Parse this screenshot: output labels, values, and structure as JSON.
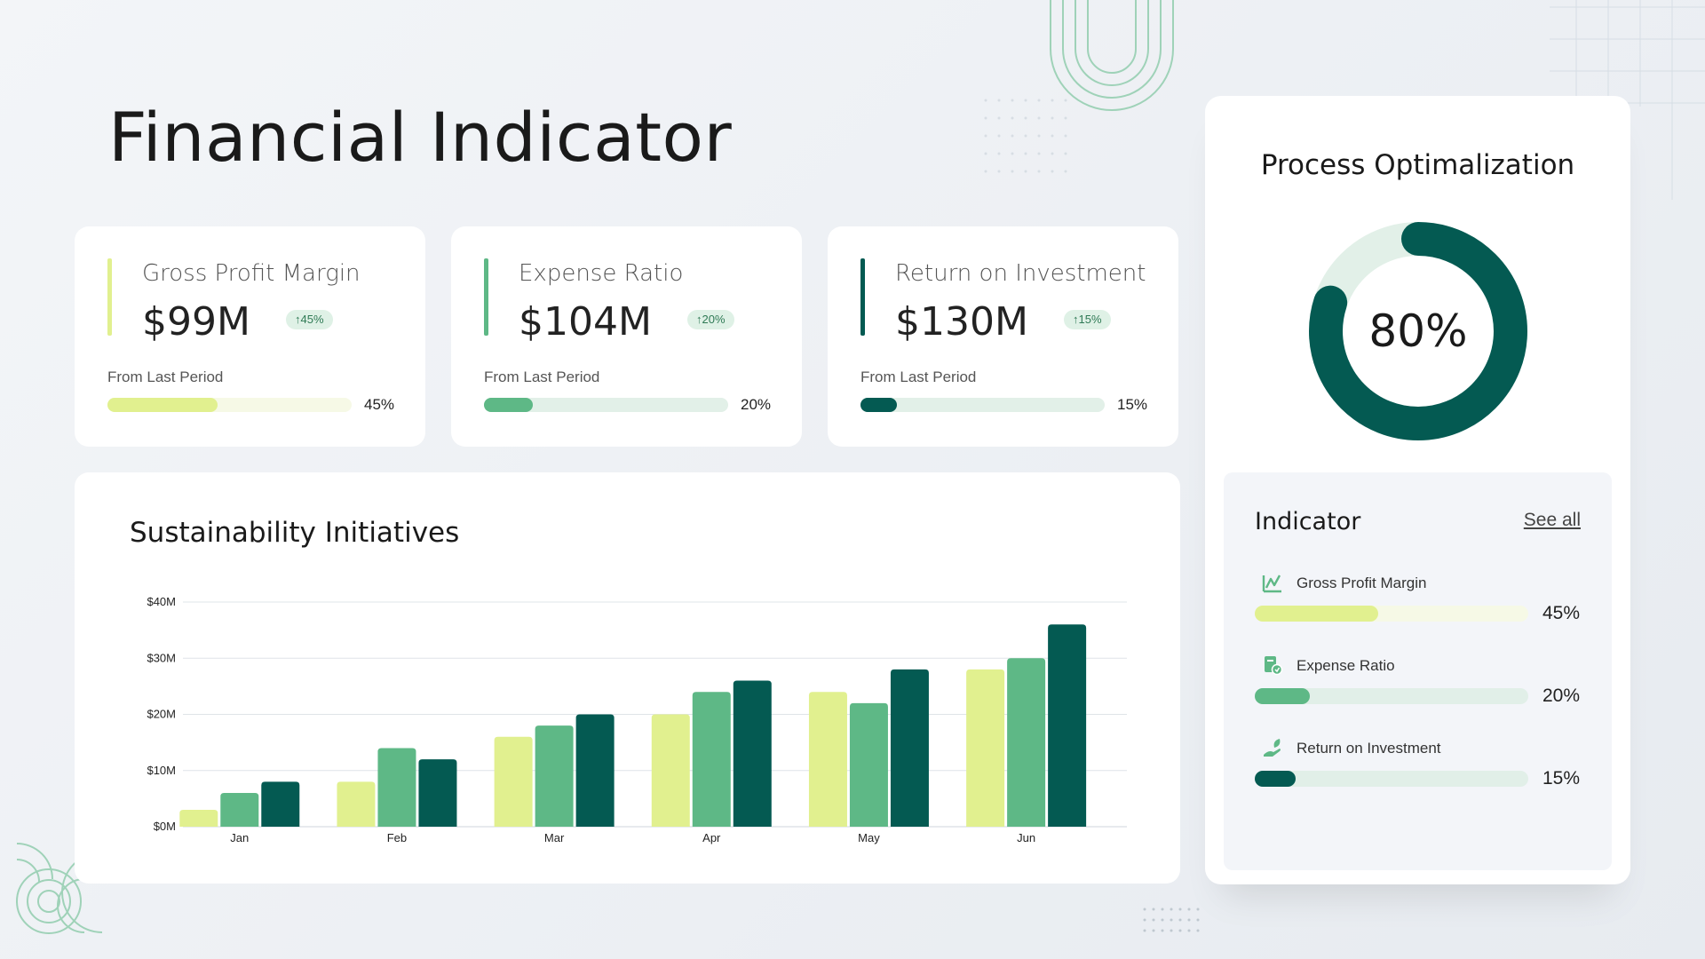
{
  "page_title": "Financial Indicator",
  "colors": {
    "light": "#e1f08f",
    "mid": "#5eb886",
    "dark": "#045a52",
    "light_track": "#f6f9e6",
    "mid_track": "#e2f0e8",
    "dark_track": "#e2f0e8"
  },
  "kpis": [
    {
      "label": "Gross Profit Margin",
      "value": "$99M",
      "badge": "↑45%",
      "from": "From Last Period",
      "pct_text": "45%",
      "progress": 0.45
    },
    {
      "label": "Expense Ratio",
      "value": "$104M",
      "badge": "↑20%",
      "from": "From Last Period",
      "pct_text": "20%",
      "progress": 0.2
    },
    {
      "label": "Return on Investment",
      "value": "$130M",
      "badge": "↑15%",
      "from": "From Last Period",
      "pct_text": "15%",
      "progress": 0.15
    }
  ],
  "chart": {
    "title": "Sustainability Initiatives"
  },
  "chart_data": {
    "type": "bar",
    "categories": [
      "Jan",
      "Feb",
      "Mar",
      "Apr",
      "May",
      "Jun"
    ],
    "series": [
      {
        "values": [
          3,
          8,
          16,
          20,
          24,
          28
        ]
      },
      {
        "values": [
          6,
          14,
          18,
          24,
          22,
          30
        ]
      },
      {
        "values": [
          8,
          12,
          20,
          26,
          28,
          36
        ]
      }
    ],
    "yticks": [
      "$0M",
      "$10M",
      "$20M",
      "$30M",
      "$40M"
    ],
    "ylim": [
      0,
      40
    ],
    "grid": true
  },
  "process": {
    "title": "Process Optimalization",
    "value_text": "80%",
    "value": 0.8
  },
  "indicator": {
    "title": "Indicator",
    "see_all": "See all",
    "rows": [
      {
        "name": "Gross Profit Margin",
        "pct_text": "45%",
        "progress": 0.45,
        "icon": "growth-chart-icon"
      },
      {
        "name": "Expense Ratio",
        "pct_text": "20%",
        "progress": 0.2,
        "icon": "expense-document-icon"
      },
      {
        "name": "Return on Investment",
        "pct_text": "15%",
        "progress": 0.15,
        "icon": "hand-plant-icon"
      }
    ]
  }
}
